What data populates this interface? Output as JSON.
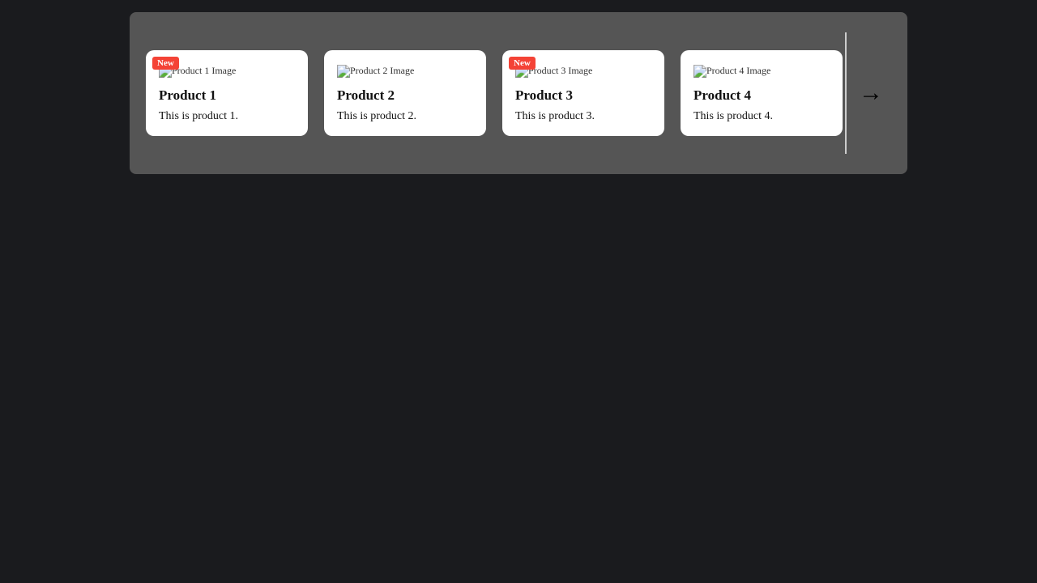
{
  "page": {
    "background": "#1a1b1e"
  },
  "carousel": {
    "products": [
      {
        "id": 1,
        "title": "Product 1",
        "description": "This is product 1.",
        "image_alt": "Product 1 Image",
        "is_new": true
      },
      {
        "id": 2,
        "title": "Product 2",
        "description": "This is product 2.",
        "image_alt": "Product 2 Image",
        "is_new": false
      },
      {
        "id": 3,
        "title": "Product 3",
        "description": "This is product 3.",
        "image_alt": "Product 3 Image",
        "is_new": true
      },
      {
        "id": 4,
        "title": "Product 4",
        "description": "This is product 4.",
        "image_alt": "Product 4 Image",
        "is_new": false
      }
    ],
    "new_badge_label": "New",
    "next_arrow": "→"
  }
}
